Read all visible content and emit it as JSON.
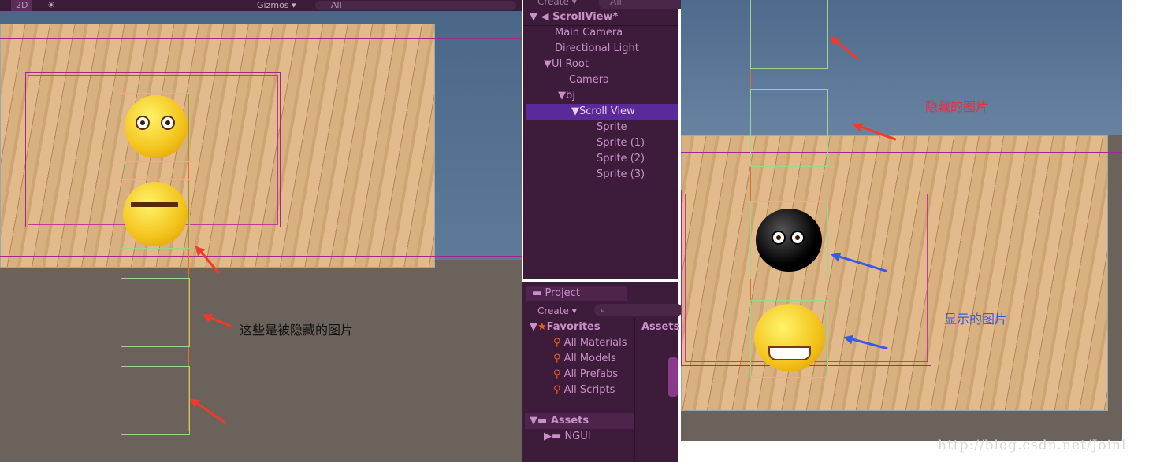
{
  "scene_toolbar": {
    "mode_2d": "2D",
    "gizmos": "Gizmos ▾",
    "search_placeholder": "All"
  },
  "hierarchy": {
    "create": "Create ▾",
    "search_placeholder": "All",
    "scene": "ScrollView*",
    "items": [
      "Main Camera",
      "Directional Light",
      "UI Root",
      "Camera",
      "bj",
      "Scroll View",
      "Sprite",
      "Sprite (1)",
      "Sprite (2)",
      "Sprite (3)"
    ],
    "selected": "Scroll View"
  },
  "project": {
    "tab": "Project",
    "create": "Create ▾",
    "favorites": "Favorites",
    "favorite_items": [
      "All Materials",
      "All Models",
      "All Prefabs",
      "All Scripts"
    ],
    "assets": "Assets",
    "asset_items": [
      "NGUI"
    ],
    "assets_header": "Assets"
  },
  "annotations": {
    "hidden_left": "这些是被隐藏的图片",
    "hidden_right": "隐藏的图片",
    "shown_right": "显示的图片"
  },
  "watermark": "http://blog.csdn.net/Joinl",
  "colors": {
    "arrow_red": "#f03a2a",
    "arrow_blue": "#3a5ae0",
    "hidden_text": "#e8303a",
    "shown_text": "#3a5ae0",
    "selection": "#5a2a9a"
  }
}
